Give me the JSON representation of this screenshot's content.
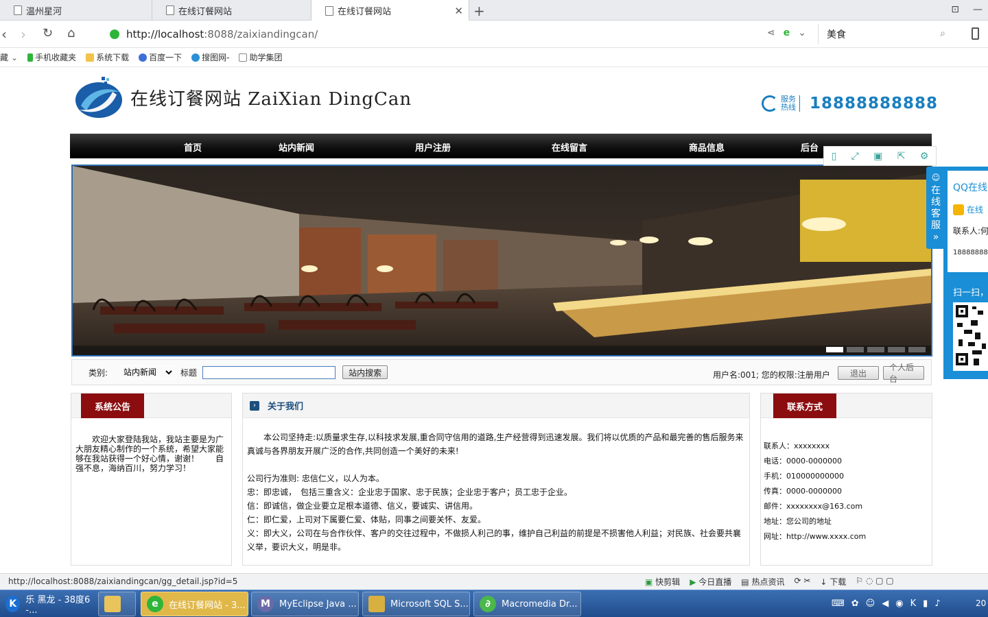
{
  "browser": {
    "tabs": [
      {
        "label": "温州星河",
        "active": false
      },
      {
        "label": "在线订餐网站",
        "active": false
      },
      {
        "label": "在线订餐网站",
        "active": true
      }
    ],
    "url_host": "http://localhost",
    "url_path": ":8088/zaixiandingcan/",
    "search_value": "美食",
    "bookmarks": [
      "藏",
      "手机收藏夹",
      "系统下载",
      "百度一下",
      "搜图网-",
      "助学集团"
    ],
    "status_url": "http://localhost:8088/zaixiandingcan/gg_detail.jsp?id=5",
    "status_items": [
      "快剪辑",
      "今日直播",
      "热点资讯",
      "下载"
    ]
  },
  "site": {
    "title": "在线订餐网站 ZaiXian DingCan",
    "hotline_label": "服务热线",
    "hotline_number": "18888888888",
    "menu": [
      "首页",
      "站内新闻",
      "用户注册",
      "在线留言",
      "商品信息",
      "后台"
    ]
  },
  "search": {
    "category_label": "类别:",
    "category_value": "站内新闻",
    "title_label": "标题",
    "title_value": "",
    "search_button": "站内搜索",
    "user_info": "用户名:001; 您的权限:注册用户",
    "logout_button": "退出",
    "profile_button": "个人后台"
  },
  "notice": {
    "heading": "系统公告",
    "text": "欢迎大家登陆我站，我站主要是为广大朋友精心制作的一个系统，希望大家能够在我站获得一个好心情，谢谢！　　自强不息，海纳百川，努力学习！"
  },
  "about": {
    "heading": "关于我们",
    "intro": "本公司坚持走:以质量求生存,以科技求发展,重合同守信用的道路,生产经营得到迅速发展。我们将以优质的产品和最完善的售后服务来真诚与各界朋友开展广泛的合作,共同创造一个美好的未来!",
    "lines": [
      "公司行为准则: 忠信仁义，以人为本。",
      "忠：即忠诚，　包括三重含义：企业忠于国家、忠于民族；企业忠于客户；员工忠于企业。",
      "信：即诚信，做企业要立足根本道德、信义，要诚实、讲信用。",
      "仁：即仁爱，上司对下属要仁爱、体贴，同事之间要关怀、友爱。",
      "义：即大义，公司在与合作伙伴、客户的交往过程中，不做损人利己的事，维护自己利益的前提是不损害他人利益；对民族、社会要共襄义举，要识大义，明是非。"
    ]
  },
  "contact": {
    "heading": "联系方式",
    "rows": [
      "联系人：xxxxxxxx",
      "电话：0000-0000000",
      "手机：010000000000",
      "传真：0000-0000000",
      "邮件：xxxxxxxx@163.com",
      "地址：您公司的地址",
      "网址：http://www.xxxx.com"
    ]
  },
  "qq": {
    "tab_label": "在线客服",
    "title": "QQ在线",
    "online": "在线",
    "contact": "联系人:何",
    "phone": "188888888",
    "scan": "扫一扫，"
  },
  "taskbar": {
    "items": [
      "乐 黑龙 - 38度6 -...",
      "",
      "在线订餐网站 - 3...",
      "MyEclipse Java ...",
      "Microsoft SQL S...",
      "Macromedia Dr..."
    ],
    "clock": "20"
  },
  "colors": {
    "accent_red": "#8b0d10",
    "accent_blue": "#1a7fbf",
    "qq_blue": "#1a8ed6",
    "about_blue": "#1c4e7e"
  }
}
